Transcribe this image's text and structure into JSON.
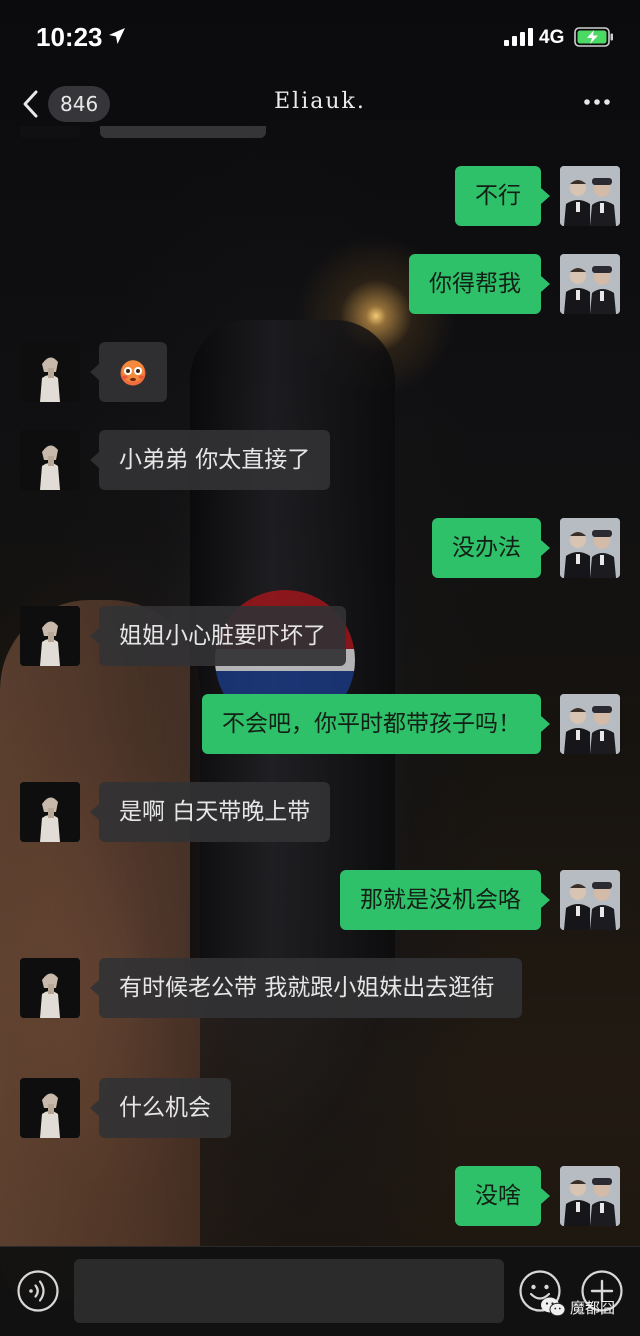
{
  "status_bar": {
    "time": "10:23",
    "network": "4G"
  },
  "nav": {
    "unread_count": "846",
    "title": "Eliauk."
  },
  "messages": [
    {
      "side": "out",
      "text": "不行"
    },
    {
      "side": "out",
      "text": "你得帮我"
    },
    {
      "side": "in",
      "text": "",
      "emoji": "flushed-face"
    },
    {
      "side": "in",
      "text": "小弟弟 你太直接了"
    },
    {
      "side": "out",
      "text": "没办法"
    },
    {
      "side": "in",
      "text": "姐姐小心脏要吓坏了"
    },
    {
      "side": "out",
      "text": "不会吧，你平时都带孩子吗！"
    },
    {
      "side": "in",
      "text": "是啊 白天带晚上带"
    },
    {
      "side": "out",
      "text": "那就是没机会咯"
    },
    {
      "side": "in",
      "text": "有时候老公带 我就跟小姐妹出去逛街"
    },
    {
      "side": "in",
      "text": "什么机会"
    },
    {
      "side": "out",
      "text": "没啥"
    }
  ],
  "input": {
    "placeholder": ""
  },
  "watermark": {
    "text": "魔都囧"
  },
  "colors": {
    "outgoing_bubble": "#2fc06a",
    "incoming_bubble": "#323234",
    "battery_charging": "#4cd964"
  }
}
